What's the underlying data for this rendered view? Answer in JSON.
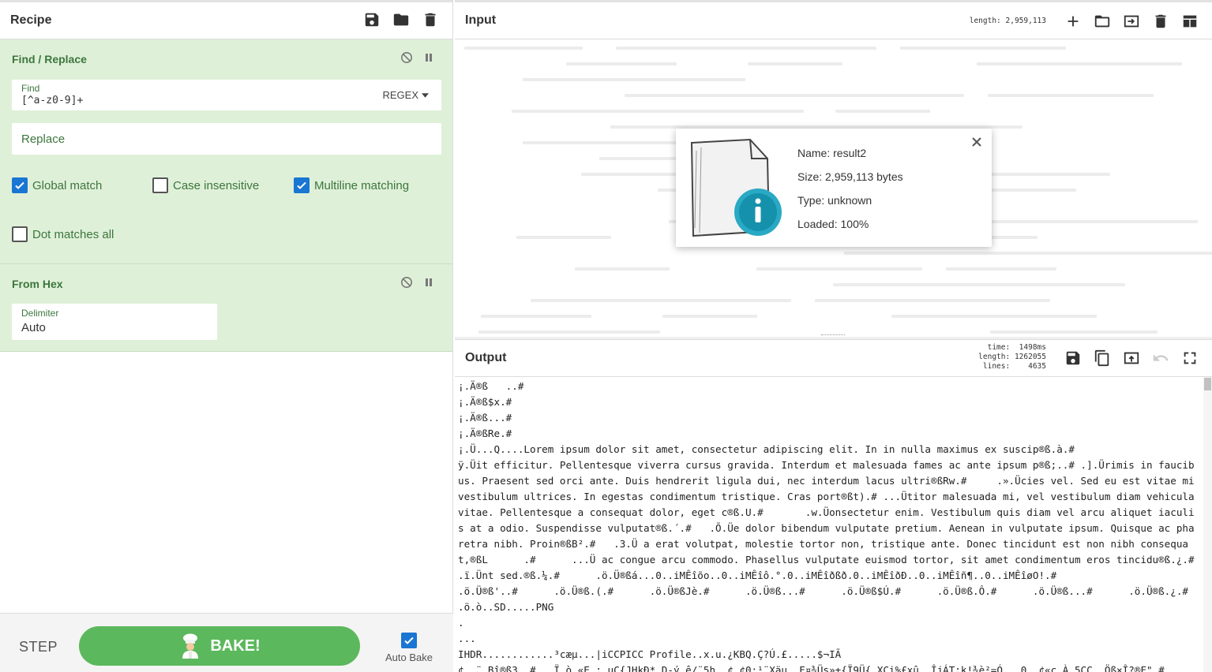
{
  "recipe": {
    "title": "Recipe",
    "operations": [
      {
        "name": "Find / Replace",
        "find_label": "Find",
        "find_value": "[^a-z0-9]+",
        "find_mode": "REGEX",
        "replace_placeholder": "Replace",
        "options": [
          {
            "label": "Global match",
            "checked": true
          },
          {
            "label": "Case insensitive",
            "checked": false
          },
          {
            "label": "Multiline matching",
            "checked": true
          },
          {
            "label": "Dot matches all",
            "checked": false
          }
        ]
      },
      {
        "name": "From Hex",
        "delimiter_label": "Delimiter",
        "delimiter_value": "Auto"
      }
    ]
  },
  "controls": {
    "step_label": "STEP",
    "bake_label": "BAKE!",
    "autobake_label": "Auto Bake",
    "autobake_checked": true
  },
  "input": {
    "title": "Input",
    "length_label": "length:",
    "length_value": "2,959,113"
  },
  "file_info": {
    "name": "Name: result2",
    "size": "Size: 2,959,113 bytes",
    "type": "Type: unknown",
    "loaded": "Loaded: 100%"
  },
  "output": {
    "title": "Output",
    "time_label": "time:",
    "time_value": "1498ms",
    "length_label": "length:",
    "length_value": "1262055",
    "lines_label": "lines:",
    "lines_value": "4635",
    "lines": [
      "¡.Ä®ß   ..#",
      "¡.Ä®ß$x.#",
      "¡.Ä®ß...#",
      "¡.Ä®ßRe.#",
      "¡.Ü...Q....Lorem ipsum dolor sit amet, consectetur adipiscing elit. In in nulla maximus ex suscip®ß.à.#",
      "ÿ.Üit efficitur. Pellentesque viverra cursus gravida. Interdum et malesuada fames ac ante ipsum p®ß;..# .].Ürimis in faucibus. Praesent sed orci ante. Duis hendrerit ligula dui, nec interdum lacus ultri®ßRw.#     .».Ücies vel. Sed eu est vitae mi vestibulum ultrices. In egestas condimentum tristique. Cras port®ßt).# ...Ütitor malesuada mi, vel vestibulum diam vehicula vitae. Pellentesque a consequat dolor, eget c®ß.U.#       .w.Üonsectetur enim. Vestibulum quis diam vel arcu aliquet iaculis at a odio. Suspendisse vulputat®ß.´.#   .Õ.Üe dolor bibendum vulputate pretium. Aenean in vulputate ipsum. Quisque ac pharetra nibh. Proin®ßB².#   .3.Ü a erat volutpat, molestie tortor non, tristique ante. Donec tincidunt est non nibh consequat,®ßL      .#      ...Ü ac congue arcu commodo. Phasellus vulputate euismod tortor, sit amet condimentum eros tincidu®ß.¿.#   .ï.Ünt sed.®ß.¼.#      .ö.Ü®ßá...0..iMÊîõo..0..iMÊîô.°.0..iMÊîðßð.0..iMÊîðÐ..0..iMÊîñ¶..0..iMÊîøO!.#",
      ".ö.Ü®ß'..#      .ö.Ü®ß.(.#      .ö.Ü®ßJè.#      .ö.Ü®ß...#      .ö.Ü®ß$Ú.#      .ö.Ü®ß.Ô.#      .ö.Ü®ß...#      .ö.Ü®ß.¿.#",
      ".ö.ò..SD.....PNG",
      ".",
      "...",
      "IHDR............³cæµ...|iCCPICC Profile..x.u.¿KBQ.Ç?Ú.£.....$¬IÃ",
      "¢..¨.Bî®ß3..#...Ï.ò.«E.;.uC{JHkÐ*.D-ý.ê/¨5h..¢.¢0:¹¨Xäu..F¤¾Üs»±{Ï9Ü{.XCi%£xû..ÎjÁT;k!¾è²=Ó...0..¢«c.À.5CC..Öß×Î?®F\".#"
    ]
  },
  "colors": {
    "operation_bg": "#dff0d8",
    "operation_text": "#3c763d",
    "bake": "#5cb85c",
    "checkbox": "#1976d2"
  }
}
